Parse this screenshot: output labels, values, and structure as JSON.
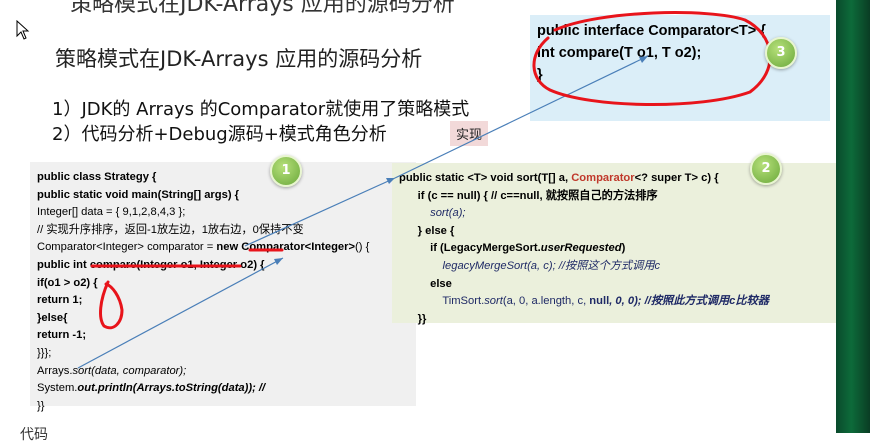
{
  "slide": {
    "cut_title": "策略模式在JDK-Arrays 应用的源码分析",
    "title": "策略模式在JDK-Arrays 应用的源码分析",
    "bullets": [
      "1）JDK的 Arrays 的Comparator就使用了策略模式",
      "2）代码分析+Debug源码+模式角色分析"
    ],
    "tag": "实现",
    "bottom_cut": "代码"
  },
  "interface_code": {
    "line1": "public interface Comparator<T> {",
    "line2": "int compare(T o1, T o2);",
    "line3": "}"
  },
  "strategy_code": {
    "l1": "public class Strategy {",
    "l2": "public static void main(String[] args) {",
    "l3": "Integer[] data = { 9,1,2,8,4,3 };",
    "l4": "// 实现升序排序，返回-1放左边，1放右边，0保持不变",
    "l5a": "Comparator<Integer> comparator = ",
    "l5b": "new Comparator<Integer>",
    "l5c": "() {",
    "l6": "public int compare(Integer o1, Integer o2) {",
    "l7": "if(o1 > o2) {",
    "l8": "return 1;",
    "l9": "}else{",
    "l10": "return -1;",
    "l11": "}}};",
    "l12a": "Arrays.",
    "l12b": "sort",
    "l12c": "(data, comparator);",
    "l13a": "System.",
    "l13b": "out",
    "l13c": ".println(Arrays.",
    "l13d": "toString",
    "l13e": "(data)); //",
    "l14": "}}"
  },
  "sort_code": {
    "l1a": "public static <T> void sort(T[] a, ",
    "l1b": "Comparator",
    "l1c": "<? super T> c) {",
    "l2": "if (c == null) { // c==null, 就按照自己的方法排序",
    "l3": "sort(a);",
    "l4": "} else {",
    "l5a": "if (LegacyMergeSort.",
    "l5b": "userRequested",
    "l5c": ")",
    "l6a": "legacyMergeSort(a, c);",
    "l6b": " //按照这个方式调用c",
    "l7": "else",
    "l8a": "TimSort.",
    "l8b": "sort",
    "l8c": "(a, 0, a.length, c, ",
    "l8d": "null",
    "l8e": ", 0, 0); //按照此方式调用c比较器",
    "l9": "}}"
  },
  "markers": [
    "1",
    "2",
    "3"
  ],
  "colors": {
    "interface_bg": "#dbeef8",
    "strategy_bg": "#f0f0f0",
    "sort_bg": "#ebf0dc",
    "annotation_red": "#e8141b",
    "arrow_blue": "#4a7fb8",
    "marker_green": "#7bb542"
  }
}
